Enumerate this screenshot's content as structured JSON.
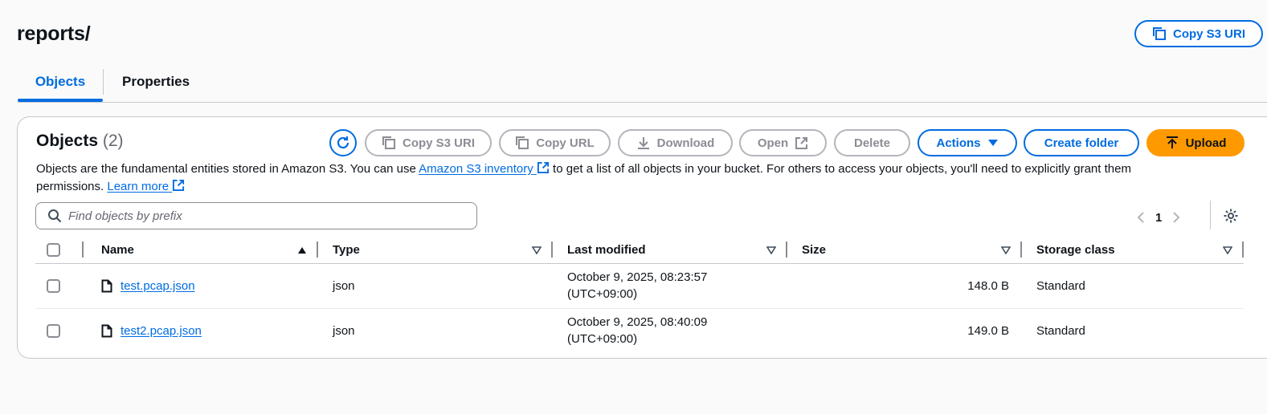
{
  "page": {
    "title": "reports/",
    "copy_s3_uri_label": "Copy S3 URI"
  },
  "tabs": [
    {
      "label": "Objects",
      "active": true
    },
    {
      "label": "Properties",
      "active": false
    }
  ],
  "objects_panel": {
    "heading": "Objects",
    "count": "(2)",
    "actions": {
      "copy_s3_uri": "Copy S3 URI",
      "copy_url": "Copy URL",
      "download": "Download",
      "open": "Open",
      "delete": "Delete",
      "actions": "Actions",
      "create_folder": "Create folder",
      "upload": "Upload"
    },
    "description": {
      "part1": "Objects are the fundamental entities stored in Amazon S3. You can use ",
      "link1": "Amazon S3 inventory",
      "part2": " to get a list of all objects in your bucket. For others to access your objects, you'll need to explicitly grant them permissions. ",
      "link2": "Learn more"
    },
    "search": {
      "placeholder": "Find objects by prefix",
      "value": ""
    },
    "pagination": {
      "current_page": "1"
    }
  },
  "table": {
    "columns": [
      "Name",
      "Type",
      "Last modified",
      "Size",
      "Storage class"
    ],
    "rows": [
      {
        "name": "test.pcap.json",
        "type": "json",
        "modified_line1": "October 9, 2025, 08:23:57",
        "modified_line2": "(UTC+09:00)",
        "size": "148.0 B",
        "storage_class": "Standard"
      },
      {
        "name": "test2.pcap.json",
        "type": "json",
        "modified_line1": "October 9, 2025, 08:40:09",
        "modified_line2": "(UTC+09:00)",
        "size": "149.0 B",
        "storage_class": "Standard"
      }
    ]
  },
  "colors": {
    "accent": "#006ce0",
    "upload": "#ff9900",
    "disabled": "#8c8c94"
  }
}
